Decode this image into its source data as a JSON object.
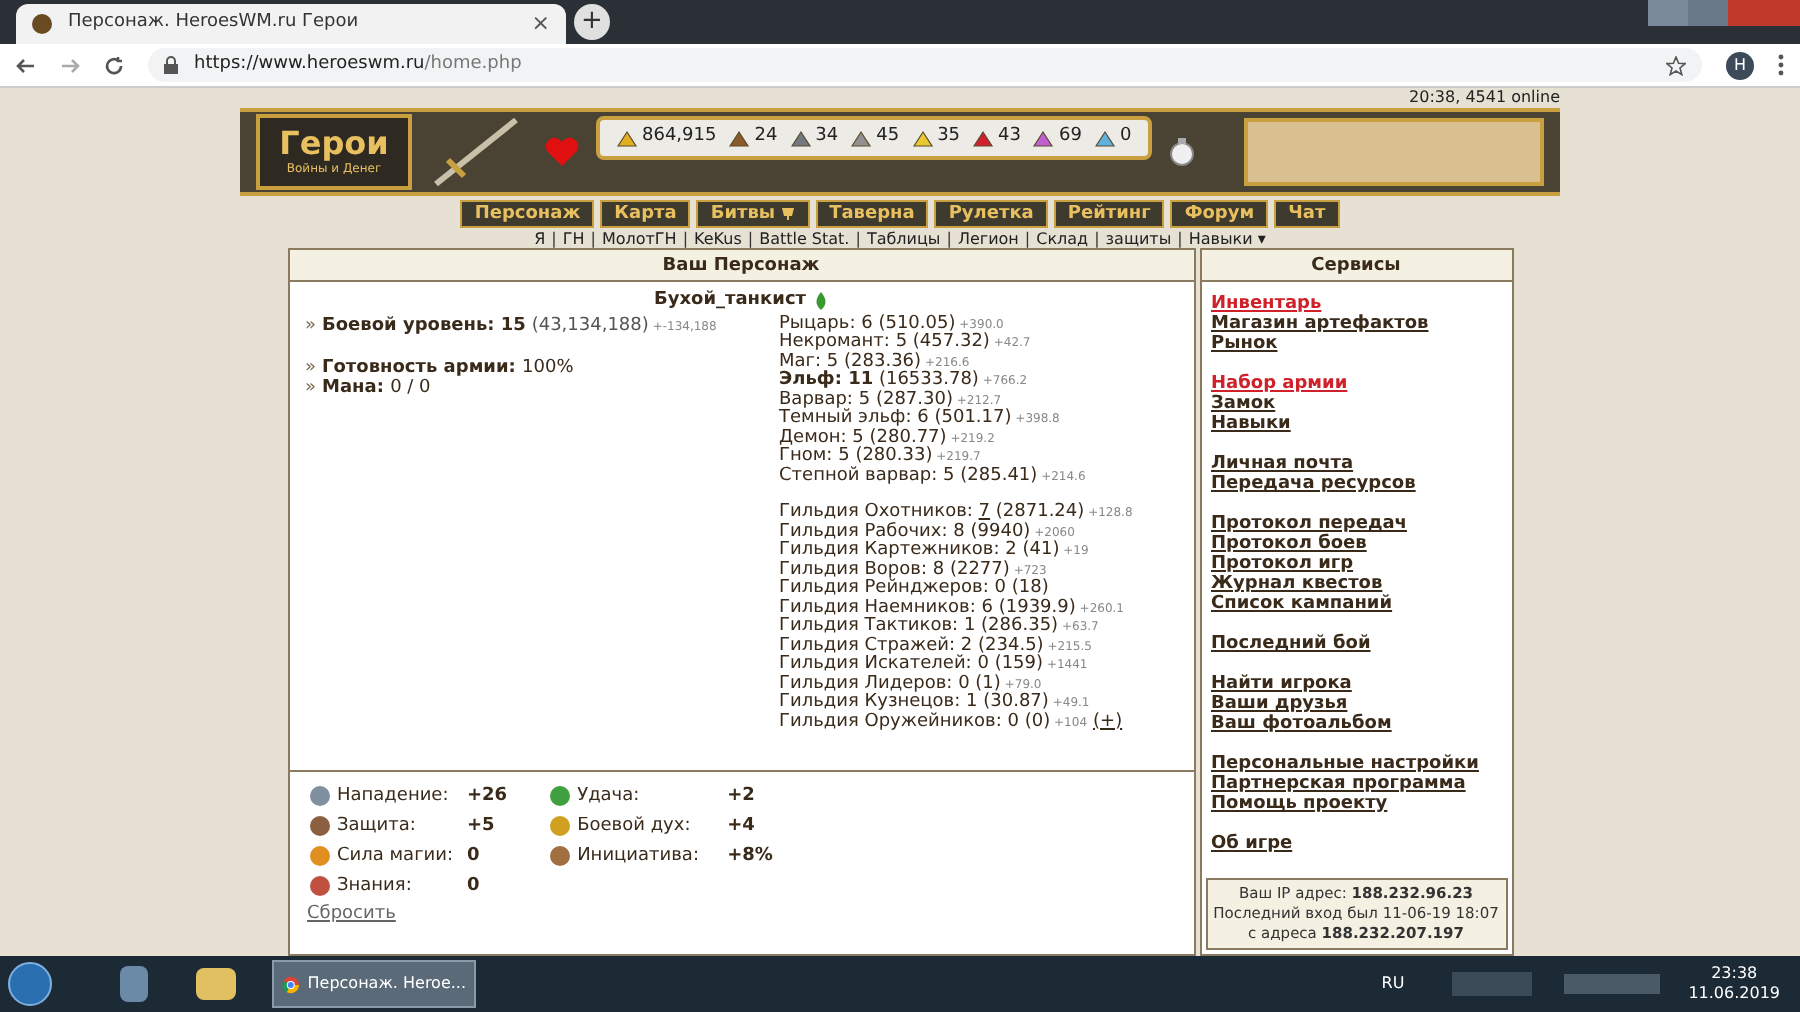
{
  "browser": {
    "tab_title": "Персонаж. HeroesWM.ru Герои",
    "tab_close": "×",
    "new_tab": "+",
    "url_host": "https://www.heroeswm.ru",
    "url_path": "/home.php",
    "profile": "H"
  },
  "header": {
    "logo_title": "Герои",
    "logo_subtitle": "Войны и Денег",
    "online": "20:38, 4541 online",
    "resources": [
      {
        "kind": "gold",
        "value": "864,915"
      },
      {
        "kind": "wood",
        "value": "24"
      },
      {
        "kind": "ore",
        "value": "34"
      },
      {
        "kind": "mercury",
        "value": "45"
      },
      {
        "kind": "sulfur",
        "value": "35"
      },
      {
        "kind": "crystal",
        "value": "43"
      },
      {
        "kind": "gems",
        "value": "69"
      },
      {
        "kind": "diamond",
        "value": "0"
      }
    ],
    "nav": [
      {
        "label": "Персонаж",
        "badge": false
      },
      {
        "label": "Карта",
        "badge": false
      },
      {
        "label": "Битвы",
        "badge": true
      },
      {
        "label": "Таверна",
        "badge": false
      },
      {
        "label": "Рулетка",
        "badge": false
      },
      {
        "label": "Рейтинг",
        "badge": false
      },
      {
        "label": "Форум",
        "badge": false
      },
      {
        "label": "Чат",
        "badge": false
      }
    ],
    "subnav_separator": "|",
    "subnav": [
      "Я",
      "ГН",
      "МолотГН",
      "KeKus",
      "Battle Stat.",
      "Таблицы",
      "Легион",
      "Склад",
      "защиты",
      "Навыки ▾"
    ]
  },
  "character": {
    "title": "Ваш Персонаж",
    "name": "Бухой_танкист",
    "bullet": "»",
    "stat_groups": [
      [
        {
          "label": "Боевой уровень:",
          "value": "15",
          "extra": "(43,134,188)",
          "delta": "+-134,188"
        }
      ],
      [
        {
          "label": "Готовность армии:",
          "value": "100%"
        },
        {
          "label": "Мана:",
          "value": "0 / 0"
        }
      ]
    ],
    "factions": [
      {
        "name": "Рыцарь:",
        "level": "6",
        "points": "(510.05)",
        "delta": "+390.0",
        "current": false
      },
      {
        "name": "Некромант:",
        "level": "5",
        "points": "(457.32)",
        "delta": "+42.7",
        "current": false
      },
      {
        "name": "Маг:",
        "level": "5",
        "points": "(283.36)",
        "delta": "+216.6",
        "current": false
      },
      {
        "name": "Эльф:",
        "level": "11",
        "points": "(16533.78)",
        "delta": "+766.2",
        "current": true
      },
      {
        "name": "Варвар:",
        "level": "5",
        "points": "(287.30)",
        "delta": "+212.7",
        "current": false
      },
      {
        "name": "Темный эльф:",
        "level": "6",
        "points": "(501.17)",
        "delta": "+398.8",
        "current": false
      },
      {
        "name": "Демон:",
        "level": "5",
        "points": "(280.77)",
        "delta": "+219.2",
        "current": false
      },
      {
        "name": "Гном:",
        "level": "5",
        "points": "(280.33)",
        "delta": "+219.7",
        "current": false
      },
      {
        "name": "Степной варвар:",
        "level": "5",
        "points": "(285.41)",
        "delta": "+214.6",
        "current": false
      }
    ],
    "guilds": [
      {
        "name": "Гильдия Охотников:",
        "level": "7",
        "linked": true,
        "points": "(2871.24)",
        "delta": "+128.8"
      },
      {
        "name": "Гильдия Рабочих:",
        "level": "8",
        "linked": false,
        "points": "(9940)",
        "delta": "+2060"
      },
      {
        "name": "Гильдия Картежников:",
        "level": "2",
        "linked": false,
        "points": "(41)",
        "delta": "+19"
      },
      {
        "name": "Гильдия Воров:",
        "level": "8",
        "linked": false,
        "points": "(2277)",
        "delta": "+723"
      },
      {
        "name": "Гильдия Рейнджеров:",
        "level": "0",
        "linked": false,
        "points": "(18)"
      },
      {
        "name": "Гильдия Наемников:",
        "level": "6",
        "linked": false,
        "points": "(1939.9)",
        "delta": "+260.1"
      },
      {
        "name": "Гильдия Тактиков:",
        "level": "1",
        "linked": false,
        "points": "(286.35)",
        "delta": "+63.7"
      },
      {
        "name": "Гильдия Стражей:",
        "level": "2",
        "linked": false,
        "points": "(234.5)",
        "delta": "+215.5"
      },
      {
        "name": "Гильдия Искателей:",
        "level": "0",
        "linked": false,
        "points": "(159)",
        "delta": "+1441"
      },
      {
        "name": "Гильдия Лидеров:",
        "level": "0",
        "linked": false,
        "points": "(1)",
        "delta": "+79.0"
      },
      {
        "name": "Гильдия Кузнецов:",
        "level": "1",
        "linked": false,
        "points": "(30.87)",
        "delta": "+49.1"
      },
      {
        "name": "Гильдия Оружейников:",
        "level": "0",
        "linked": false,
        "points": "(0)",
        "delta": "+104"
      }
    ],
    "guild_add": "(+)",
    "attributes": [
      [
        {
          "kind": "attack",
          "label": "Нападение:",
          "value": "+26"
        },
        {
          "kind": "defense",
          "label": "Защита:",
          "value": "+5"
        },
        {
          "kind": "magic",
          "label": "Сила магии:",
          "value": "0"
        },
        {
          "kind": "knowledge",
          "label": "Знания:",
          "value": "0"
        }
      ],
      [
        {
          "kind": "luck",
          "label": "Удача:",
          "value": "+2"
        },
        {
          "kind": "morale",
          "label": "Боевой дух:",
          "value": "+4"
        },
        {
          "kind": "initiative",
          "label": "Инициатива:",
          "value": "+8%"
        }
      ]
    ],
    "reset": "Сбросить"
  },
  "services": {
    "title": "Сервисы",
    "groups": [
      [
        {
          "label": "Инвентарь",
          "highlight": true
        },
        {
          "label": "Магазин артефактов",
          "highlight": false
        },
        {
          "label": "Рынок",
          "highlight": false
        }
      ],
      [
        {
          "label": "Набор армии",
          "highlight": true
        },
        {
          "label": "Замок",
          "highlight": false
        },
        {
          "label": "Навыки",
          "highlight": false
        }
      ],
      [
        {
          "label": "Личная почта",
          "highlight": false
        },
        {
          "label": "Передача ресурсов",
          "highlight": false
        }
      ],
      [
        {
          "label": "Протокол передач",
          "highlight": false
        },
        {
          "label": "Протокол боев",
          "highlight": false
        },
        {
          "label": "Протокол игр",
          "highlight": false
        },
        {
          "label": "Журнал квестов",
          "highlight": false
        },
        {
          "label": "Список кампаний",
          "highlight": false
        }
      ],
      [
        {
          "label": "Последний бой",
          "highlight": false
        }
      ],
      [
        {
          "label": "Найти игрока",
          "highlight": false
        },
        {
          "label": "Ваши друзья",
          "highlight": false
        },
        {
          "label": "Ваш фотоальбом",
          "highlight": false
        }
      ],
      [
        {
          "label": "Персональные настройки",
          "highlight": false
        },
        {
          "label": "Партнерская программа",
          "highlight": false
        },
        {
          "label": "Помощь проекту",
          "highlight": false
        }
      ],
      [
        {
          "label": "Об игре",
          "highlight": false
        }
      ]
    ],
    "login_info": [
      "Ваш IP адрес: **188.232.96.23**",
      "Последний вход был 11-06-19 18:07",
      "с адреса **188.232.207.197**"
    ]
  },
  "taskbar": {
    "window_title": "Персонаж. Heroe...",
    "language": "RU",
    "time": "23:38",
    "date": "11.06.2019"
  }
}
